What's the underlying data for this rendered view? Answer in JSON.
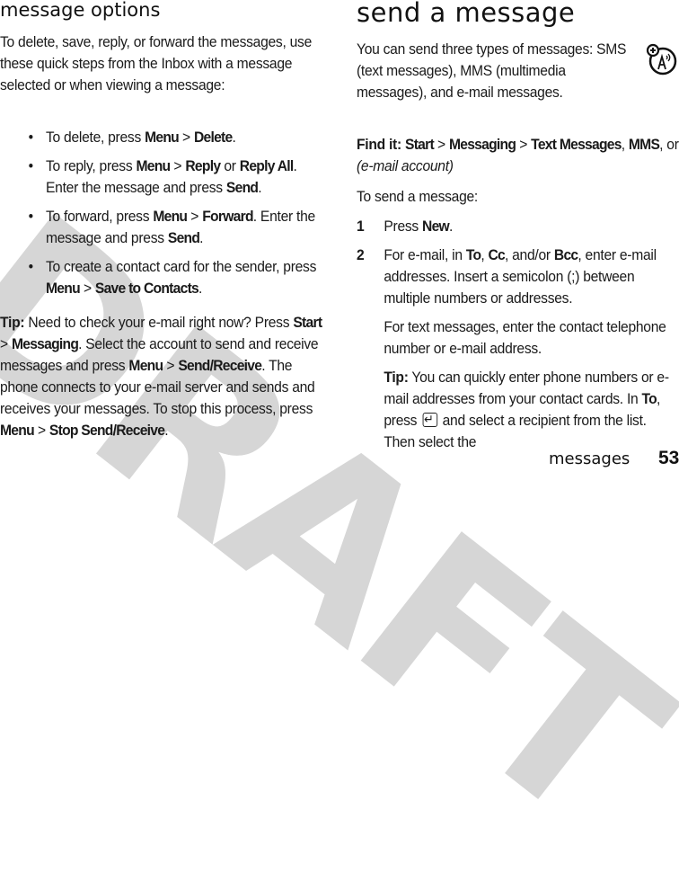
{
  "watermark": "DRAFT",
  "left": {
    "title": "message options",
    "intro": "To delete, save, reply, or forward the messages, use these quick steps from the Inbox with a message selected or when viewing a message:",
    "bullets": [
      {
        "pre": "To delete, press ",
        "k1": "Menu",
        "sep": " > ",
        "k2": "Delete",
        "post": "."
      },
      {
        "pre": "To reply, press ",
        "k1": "Menu",
        "sep": " > ",
        "k2": "Reply",
        "mid": " or ",
        "k3": "Reply All",
        "post2": ". Enter the message and press ",
        "k4": "Send",
        "post": "."
      },
      {
        "pre": "To forward, press ",
        "k1": "Menu",
        "sep": " > ",
        "k2": "Forward",
        "post2": ". Enter the message and press ",
        "k4": "Send",
        "post": "."
      },
      {
        "pre": "To create a contact card for the sender, press ",
        "k1": "Menu",
        "sep": " > ",
        "k2": "Save to Contacts",
        "post": "."
      }
    ],
    "tip": {
      "label": "Tip:",
      "t1": " Need to check your e-mail right now? Press ",
      "k1": "Start",
      "s1": " > ",
      "k2": "Messaging",
      "t2": ". Select the account to send and receive messages and press ",
      "k3": "Menu",
      "s2": " > ",
      "k4": "Send/Receive",
      "t3": ". The phone connects to your e-mail server and sends and receives your messages. To stop this process, press ",
      "k5": "Menu",
      "s3": " > ",
      "k6": "Stop Send/Receive",
      "t4": "."
    }
  },
  "right": {
    "title": "send a message",
    "intro": "You can send three types of messages: SMS (text messages), MMS (multimedia messages), and e-mail messages.",
    "icon": "messaging-shortcut-icon",
    "findit": {
      "label": "Find it:",
      "k1": "Start",
      "s1": " > ",
      "k2": "Messaging",
      "s2": " > ",
      "k3": "Text Messages",
      "c1": ", ",
      "k4": "MMS",
      "c2": ", or ",
      "italic": "(e-mail account)"
    },
    "tosend": "To send a message:",
    "steps": [
      {
        "num": "1",
        "pre": "Press ",
        "k1": "New",
        "post": "."
      },
      {
        "num": "2",
        "pre": "For e-mail, in ",
        "k1": "To",
        "c1": ", ",
        "k2": "Cc",
        "c2": ", and/or ",
        "k3": "Bcc",
        "post": ", enter e-mail addresses. Insert a semicolon (;) between multiple numbers or addresses.",
        "para2": "For text messages, enter the contact telephone number or e-mail address.",
        "tip": {
          "label": "Tip:",
          "t1": " You can quickly enter phone numbers or e-mail addresses from your contact cards. In ",
          "k1": "To",
          "t2": ", press ",
          "icon": "enter-key-icon",
          "t3": " and select a recipient from the list. Then select the"
        }
      }
    ]
  },
  "footer": {
    "section": "messages",
    "page": "53"
  }
}
